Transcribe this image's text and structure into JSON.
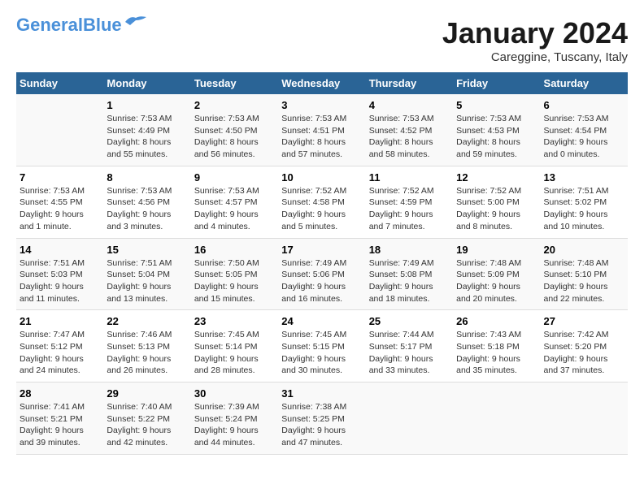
{
  "header": {
    "logo_line1": "General",
    "logo_line2": "Blue",
    "month_title": "January 2024",
    "subtitle": "Careggine, Tuscany, Italy"
  },
  "days_of_week": [
    "Sunday",
    "Monday",
    "Tuesday",
    "Wednesday",
    "Thursday",
    "Friday",
    "Saturday"
  ],
  "weeks": [
    [
      {
        "day": "",
        "info": ""
      },
      {
        "day": "1",
        "info": "Sunrise: 7:53 AM\nSunset: 4:49 PM\nDaylight: 8 hours\nand 55 minutes."
      },
      {
        "day": "2",
        "info": "Sunrise: 7:53 AM\nSunset: 4:50 PM\nDaylight: 8 hours\nand 56 minutes."
      },
      {
        "day": "3",
        "info": "Sunrise: 7:53 AM\nSunset: 4:51 PM\nDaylight: 8 hours\nand 57 minutes."
      },
      {
        "day": "4",
        "info": "Sunrise: 7:53 AM\nSunset: 4:52 PM\nDaylight: 8 hours\nand 58 minutes."
      },
      {
        "day": "5",
        "info": "Sunrise: 7:53 AM\nSunset: 4:53 PM\nDaylight: 8 hours\nand 59 minutes."
      },
      {
        "day": "6",
        "info": "Sunrise: 7:53 AM\nSunset: 4:54 PM\nDaylight: 9 hours\nand 0 minutes."
      }
    ],
    [
      {
        "day": "7",
        "info": "Sunrise: 7:53 AM\nSunset: 4:55 PM\nDaylight: 9 hours\nand 1 minute."
      },
      {
        "day": "8",
        "info": "Sunrise: 7:53 AM\nSunset: 4:56 PM\nDaylight: 9 hours\nand 3 minutes."
      },
      {
        "day": "9",
        "info": "Sunrise: 7:53 AM\nSunset: 4:57 PM\nDaylight: 9 hours\nand 4 minutes."
      },
      {
        "day": "10",
        "info": "Sunrise: 7:52 AM\nSunset: 4:58 PM\nDaylight: 9 hours\nand 5 minutes."
      },
      {
        "day": "11",
        "info": "Sunrise: 7:52 AM\nSunset: 4:59 PM\nDaylight: 9 hours\nand 7 minutes."
      },
      {
        "day": "12",
        "info": "Sunrise: 7:52 AM\nSunset: 5:00 PM\nDaylight: 9 hours\nand 8 minutes."
      },
      {
        "day": "13",
        "info": "Sunrise: 7:51 AM\nSunset: 5:02 PM\nDaylight: 9 hours\nand 10 minutes."
      }
    ],
    [
      {
        "day": "14",
        "info": "Sunrise: 7:51 AM\nSunset: 5:03 PM\nDaylight: 9 hours\nand 11 minutes."
      },
      {
        "day": "15",
        "info": "Sunrise: 7:51 AM\nSunset: 5:04 PM\nDaylight: 9 hours\nand 13 minutes."
      },
      {
        "day": "16",
        "info": "Sunrise: 7:50 AM\nSunset: 5:05 PM\nDaylight: 9 hours\nand 15 minutes."
      },
      {
        "day": "17",
        "info": "Sunrise: 7:49 AM\nSunset: 5:06 PM\nDaylight: 9 hours\nand 16 minutes."
      },
      {
        "day": "18",
        "info": "Sunrise: 7:49 AM\nSunset: 5:08 PM\nDaylight: 9 hours\nand 18 minutes."
      },
      {
        "day": "19",
        "info": "Sunrise: 7:48 AM\nSunset: 5:09 PM\nDaylight: 9 hours\nand 20 minutes."
      },
      {
        "day": "20",
        "info": "Sunrise: 7:48 AM\nSunset: 5:10 PM\nDaylight: 9 hours\nand 22 minutes."
      }
    ],
    [
      {
        "day": "21",
        "info": "Sunrise: 7:47 AM\nSunset: 5:12 PM\nDaylight: 9 hours\nand 24 minutes."
      },
      {
        "day": "22",
        "info": "Sunrise: 7:46 AM\nSunset: 5:13 PM\nDaylight: 9 hours\nand 26 minutes."
      },
      {
        "day": "23",
        "info": "Sunrise: 7:45 AM\nSunset: 5:14 PM\nDaylight: 9 hours\nand 28 minutes."
      },
      {
        "day": "24",
        "info": "Sunrise: 7:45 AM\nSunset: 5:15 PM\nDaylight: 9 hours\nand 30 minutes."
      },
      {
        "day": "25",
        "info": "Sunrise: 7:44 AM\nSunset: 5:17 PM\nDaylight: 9 hours\nand 33 minutes."
      },
      {
        "day": "26",
        "info": "Sunrise: 7:43 AM\nSunset: 5:18 PM\nDaylight: 9 hours\nand 35 minutes."
      },
      {
        "day": "27",
        "info": "Sunrise: 7:42 AM\nSunset: 5:20 PM\nDaylight: 9 hours\nand 37 minutes."
      }
    ],
    [
      {
        "day": "28",
        "info": "Sunrise: 7:41 AM\nSunset: 5:21 PM\nDaylight: 9 hours\nand 39 minutes."
      },
      {
        "day": "29",
        "info": "Sunrise: 7:40 AM\nSunset: 5:22 PM\nDaylight: 9 hours\nand 42 minutes."
      },
      {
        "day": "30",
        "info": "Sunrise: 7:39 AM\nSunset: 5:24 PM\nDaylight: 9 hours\nand 44 minutes."
      },
      {
        "day": "31",
        "info": "Sunrise: 7:38 AM\nSunset: 5:25 PM\nDaylight: 9 hours\nand 47 minutes."
      },
      {
        "day": "",
        "info": ""
      },
      {
        "day": "",
        "info": ""
      },
      {
        "day": "",
        "info": ""
      }
    ]
  ]
}
